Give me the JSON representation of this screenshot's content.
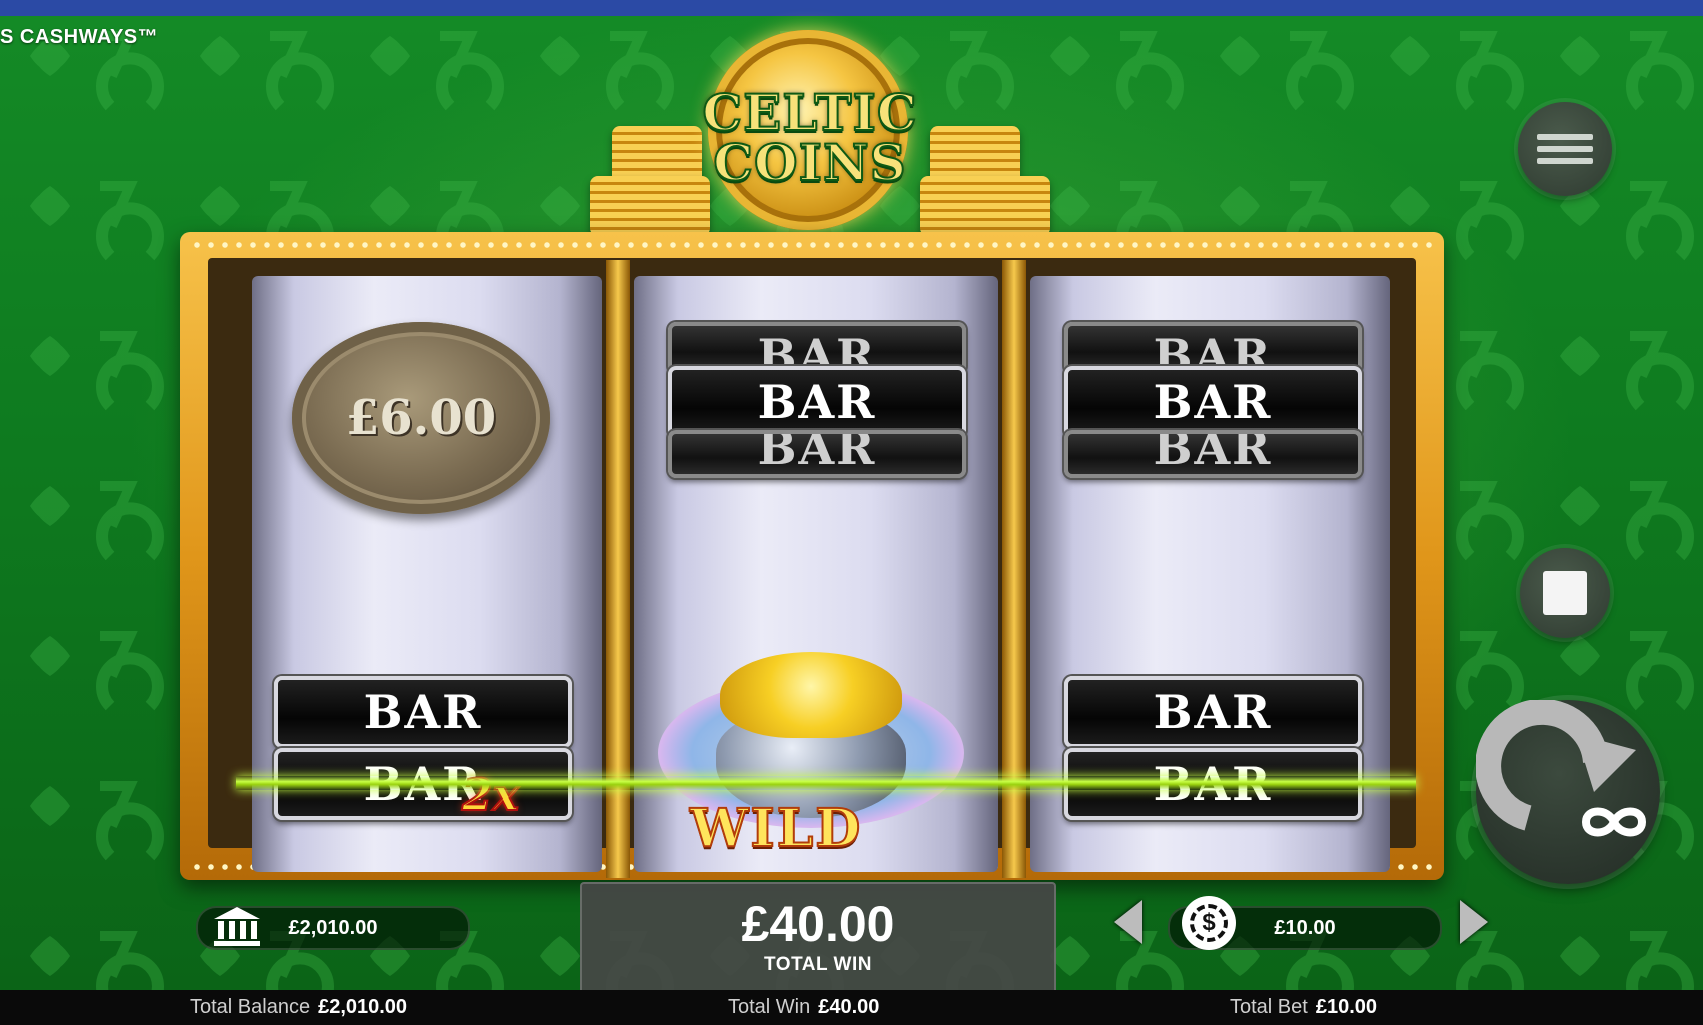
{
  "header": {
    "game_title": "S CASHWAYS™"
  },
  "logo": {
    "line1": "CELTIC",
    "line2": "COINS"
  },
  "reels": {
    "reel1": {
      "cash_coin": "£6.00",
      "bar_top": "BAR",
      "bar_bottom": "BAR",
      "multiplier": "2x"
    },
    "reel2": {
      "bars": [
        "BAR",
        "BAR",
        "BAR"
      ],
      "wild_label": "WILD"
    },
    "reel3": {
      "bars": [
        "BAR",
        "BAR",
        "BAR"
      ],
      "bar_top": "BAR",
      "bar_bottom": "BAR"
    }
  },
  "controls": {
    "menu_icon": "hamburger-menu-icon",
    "stop_icon": "stop-square-icon",
    "spin_icon": "autospin-infinity-icon",
    "accent": "#c8ff46"
  },
  "panels": {
    "balance_value": "£2,010.00",
    "win_amount": "£40.00",
    "win_label": "TOTAL WIN",
    "bet_value": "£10.00"
  },
  "status_bar": {
    "balance_label": "Total Balance",
    "balance_value": "£2,010.00",
    "win_label": "Total Win",
    "win_value": "£40.00",
    "bet_label": "Total Bet",
    "bet_value": "£10.00"
  }
}
